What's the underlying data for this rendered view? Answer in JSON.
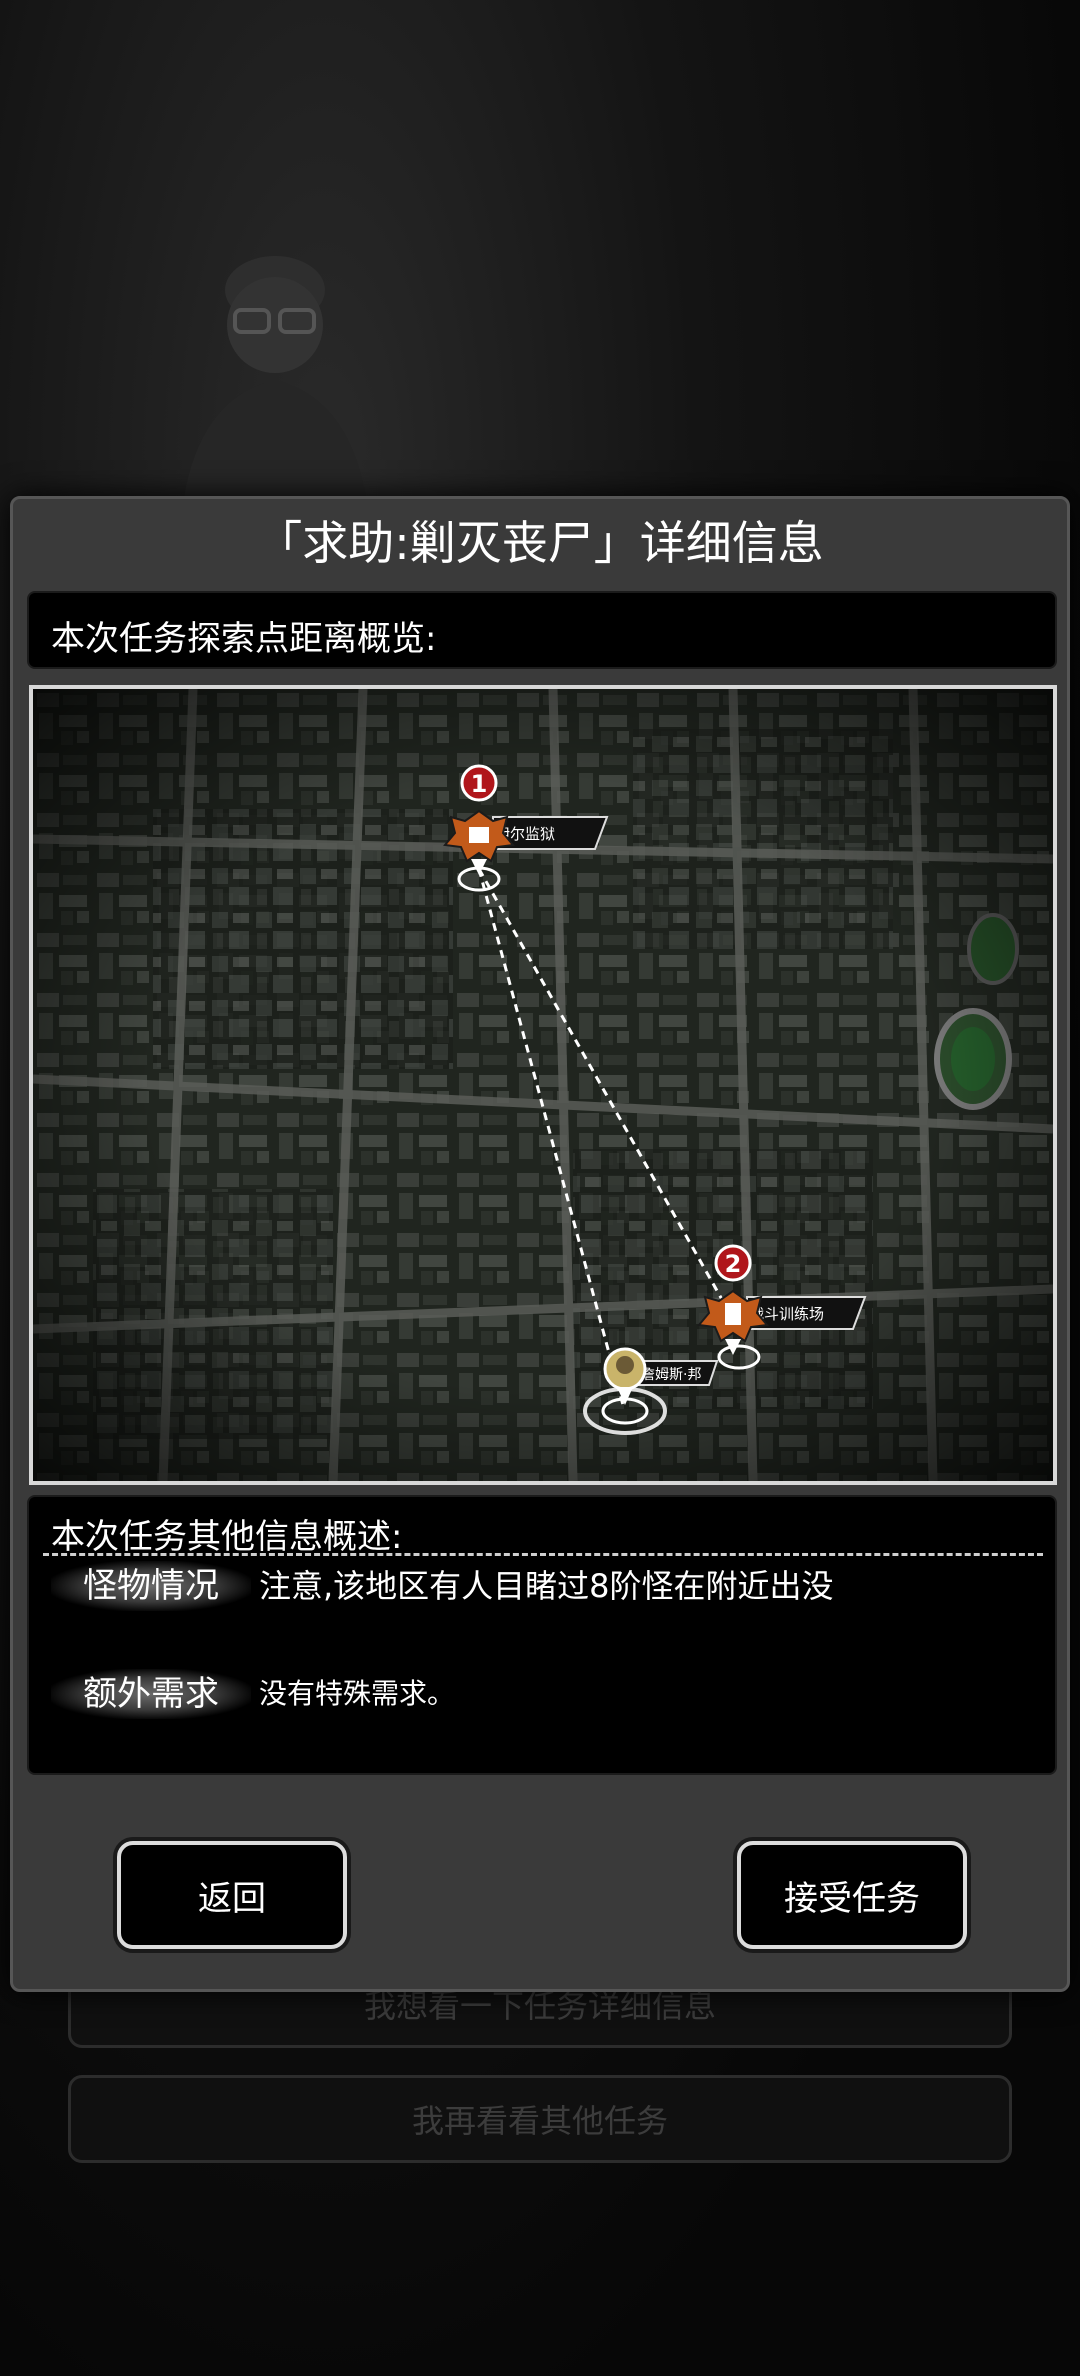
{
  "background": {
    "buttons": [
      "我想看一下任务详细信息",
      "我再看看其他任务"
    ]
  },
  "dialog": {
    "title": "「求助:剿灭丧尸」详细信息",
    "distance_header": "本次任务探索点距离概览:",
    "map": {
      "markers": [
        {
          "number": "1",
          "label": "伊尔监狱",
          "icon": "building-icon"
        },
        {
          "number": "2",
          "label": "战斗训练场",
          "icon": "building-icon"
        }
      ],
      "player": {
        "label": "詹姆斯·邦",
        "icon": "avatar-icon"
      }
    },
    "other_header": "本次任务其他信息概述:",
    "rows": [
      {
        "label": "怪物情况",
        "value": "注意,该地区有人目睹过8阶怪在附近出没"
      },
      {
        "label": "额外需求",
        "value": "没有特殊需求。"
      }
    ],
    "buttons": {
      "back": "返回",
      "accept": "接受任务"
    }
  },
  "colors": {
    "marker_red": "#b0161b",
    "marker_orange": "#c25a1a",
    "dialog_bg": "#3a3a3a"
  }
}
